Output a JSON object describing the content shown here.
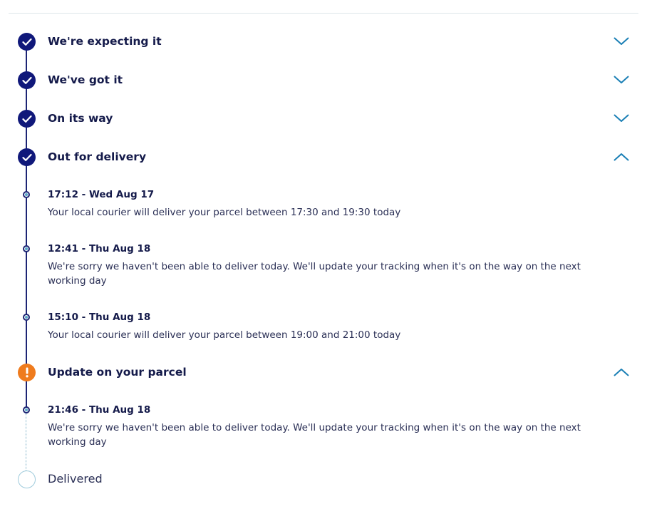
{
  "steps": [
    {
      "title": "We're expecting it",
      "status": "done",
      "chevron": "chevron-down"
    },
    {
      "title": "We've got it",
      "status": "done",
      "chevron": "chevron-down"
    },
    {
      "title": "On its way",
      "status": "done",
      "chevron": "chevron-down"
    },
    {
      "title": "Out for delivery",
      "status": "done",
      "chevron": "chevron-up",
      "events": [
        {
          "time": "17:12 - Wed Aug 17",
          "description": "Your local courier will deliver your parcel between 17:30 and 19:30 today"
        },
        {
          "time": "12:41 - Thu Aug 18",
          "description": "We're sorry we haven't been able to deliver today. We'll update your tracking when it's on the way on the next working day"
        },
        {
          "time": "15:10 - Thu Aug 18",
          "description": "Your local courier will deliver your parcel between 19:00 and 21:00 today"
        }
      ]
    },
    {
      "title": "Update on your parcel",
      "status": "warning",
      "chevron": "chevron-up",
      "events": [
        {
          "time": "21:46 - Thu Aug 18",
          "description": "We're sorry we haven't been able to deliver today. We'll update your tracking when it's on the way on the next working day"
        }
      ]
    },
    {
      "title": "Delivered",
      "status": "pending"
    }
  ],
  "colors": {
    "done": "#10187a",
    "warning": "#ef7b1d",
    "pending_border": "#9fcbdc",
    "chevron": "#1a7fb5",
    "text": "#141a4a"
  }
}
